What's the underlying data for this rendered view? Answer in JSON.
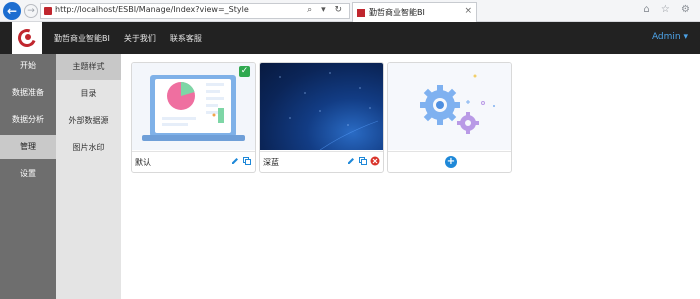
{
  "browser": {
    "url": "http://localhost/ESBI/Manage/Index?view=_Style",
    "tab_title": "勤哲商业智能BI",
    "tab_close": "×",
    "addr_icons": "⌕ ▾ ↻",
    "right_icons": "⌂ ☆ ⚙",
    "back_glyph": "←",
    "forward_glyph": "→"
  },
  "header": {
    "nav": [
      "勤哲商业智能BI",
      "关于我们",
      "联系客服"
    ],
    "user": "Admin ▾"
  },
  "sidebar_primary": {
    "items": [
      {
        "label": "开始",
        "active": false
      },
      {
        "label": "数据准备",
        "active": false
      },
      {
        "label": "数据分析",
        "active": false
      },
      {
        "label": "管理",
        "active": true
      },
      {
        "label": "设置",
        "active": false
      }
    ]
  },
  "sidebar_secondary": {
    "items": [
      {
        "label": "主题样式",
        "active": true
      },
      {
        "label": "目录",
        "active": false
      },
      {
        "label": "外部数据源",
        "active": false
      },
      {
        "label": "图片水印",
        "active": false
      }
    ]
  },
  "themes": [
    {
      "name": "默认",
      "selected": true,
      "checkmark": "✓"
    },
    {
      "name": "深蓝",
      "selected": false
    }
  ],
  "add_card": {
    "glyph": "+"
  },
  "colors": {
    "header_bg": "#222222",
    "accent": "#1e88d8",
    "brand_red": "#c0262e",
    "check_green": "#2fa84f",
    "delete_red": "#d9342b"
  }
}
